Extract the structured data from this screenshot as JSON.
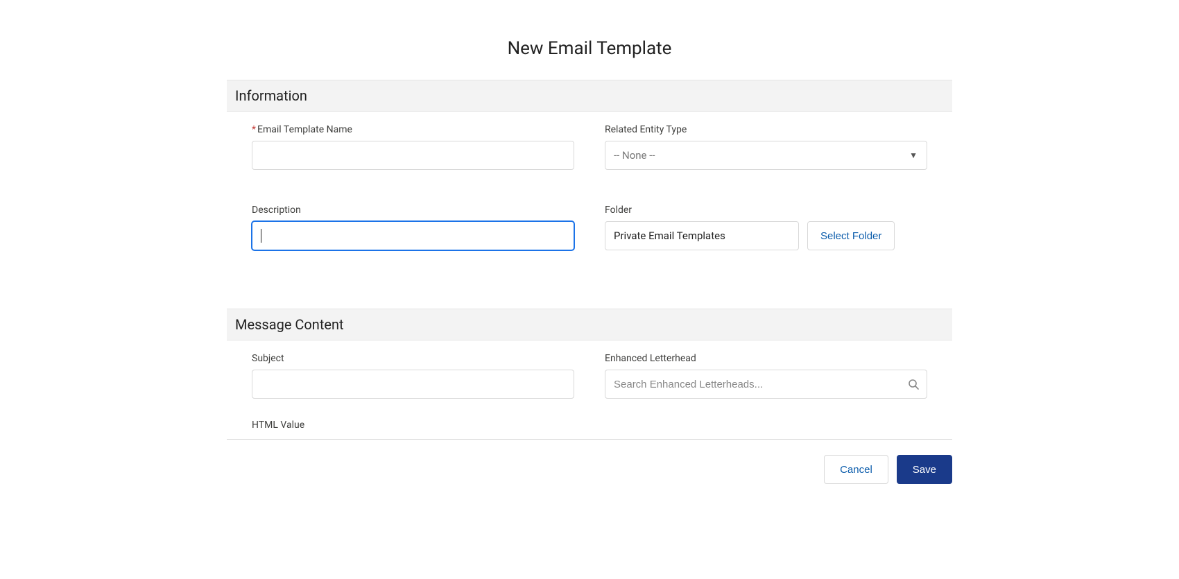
{
  "header": {
    "title": "New Email Template"
  },
  "sections": {
    "information": {
      "title": "Information",
      "fields": {
        "emailTemplateName": {
          "label": "Email Template Name",
          "value": "",
          "required": true
        },
        "relatedEntityType": {
          "label": "Related Entity Type",
          "selected": "-- None --"
        },
        "description": {
          "label": "Description",
          "value": ""
        },
        "folder": {
          "label": "Folder",
          "value": "Private Email Templates",
          "selectButton": "Select Folder"
        }
      }
    },
    "messageContent": {
      "title": "Message Content",
      "fields": {
        "subject": {
          "label": "Subject",
          "value": ""
        },
        "enhancedLetterhead": {
          "label": "Enhanced Letterhead",
          "placeholder": "Search Enhanced Letterheads..."
        },
        "htmlValue": {
          "label": "HTML Value"
        }
      }
    }
  },
  "footer": {
    "cancel": "Cancel",
    "save": "Save"
  }
}
